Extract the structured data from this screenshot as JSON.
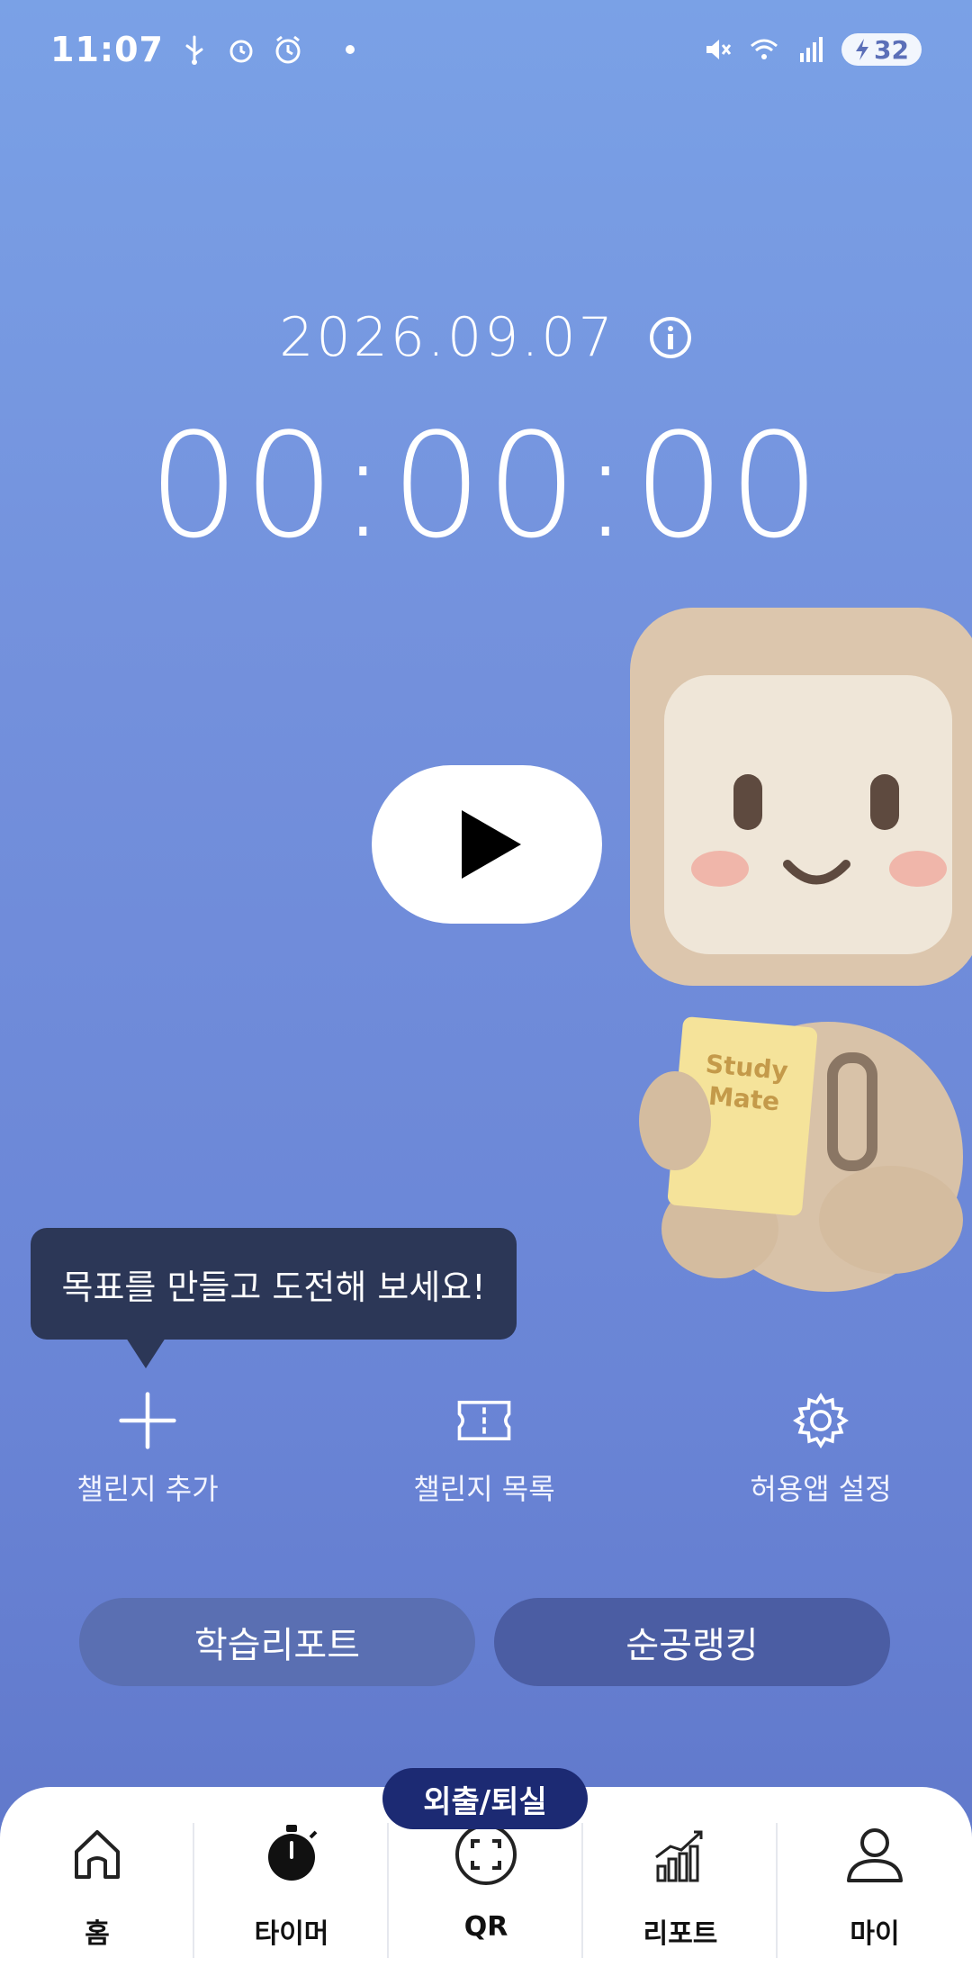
{
  "status_bar": {
    "time": "11:07",
    "left_icons": [
      "usb-icon",
      "alarm-icon",
      "alarm-clock-icon"
    ],
    "right_icons": [
      "mute-icon",
      "wifi-icon",
      "signal-icon"
    ],
    "battery": "32"
  },
  "timer": {
    "date": "2026.09.07",
    "elapsed": "00:00:00"
  },
  "mascot": {
    "book_text": "Study\nMate"
  },
  "tooltip": {
    "text": "목표를 만들고 도전해 보세요!"
  },
  "actions": [
    {
      "label": "챌린지 추가",
      "icon": "plus-icon"
    },
    {
      "label": "챌린지 목록",
      "icon": "ticket-icon"
    },
    {
      "label": "허용앱 설정",
      "icon": "gear-icon"
    }
  ],
  "buttons": {
    "report": "학습리포트",
    "ranking": "순공랭킹"
  },
  "bottom_nav": {
    "badge": "외출/퇴실",
    "items": [
      {
        "label": "홈",
        "icon": "home-icon"
      },
      {
        "label": "타이머",
        "icon": "stopwatch-icon"
      },
      {
        "label": "QR",
        "icon": "qr-scan-icon"
      },
      {
        "label": "리포트",
        "icon": "chart-icon"
      },
      {
        "label": "마이",
        "icon": "person-icon"
      }
    ]
  },
  "colors": {
    "background_top": "#7aa1e6",
    "background_bottom": "#5e75c8",
    "tooltip_bg": "#2c3757",
    "badge_bg": "#1c2a73"
  }
}
